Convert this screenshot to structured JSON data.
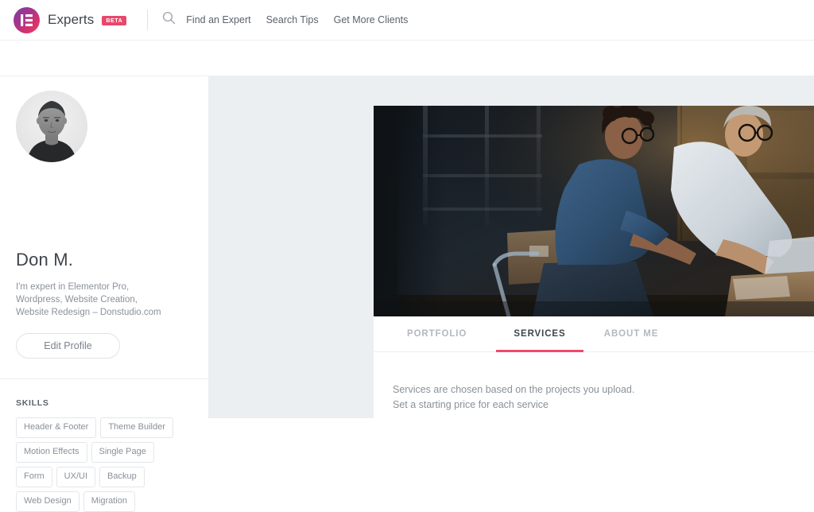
{
  "topbar": {
    "brand_name": "Experts",
    "beta_label": "BETA",
    "logo_icon": "elementor-logo-icon",
    "search_icon": "search-icon",
    "links": [
      {
        "label": "Find an Expert"
      },
      {
        "label": "Search Tips"
      },
      {
        "label": "Get More Clients"
      }
    ],
    "accent_color": "#e8486b",
    "logo_gradient_from": "#7a3f9d",
    "logo_gradient_to": "#e8476b"
  },
  "sidebar": {
    "avatar_alt": "user-avatar",
    "name": "Don M.",
    "bio": "I'm expert in Elementor Pro, Wordpress, Website Creation, Website Redesign – Donstudio.com",
    "edit_profile_label": "Edit Profile",
    "skills_title": "SKILLS",
    "skills": [
      {
        "label": "Header & Footer"
      },
      {
        "label": "Theme Builder"
      },
      {
        "label": "Motion Effects"
      },
      {
        "label": "Single Page"
      },
      {
        "label": "Form"
      },
      {
        "label": "UX/UI"
      },
      {
        "label": "Backup"
      },
      {
        "label": "Web Design"
      },
      {
        "label": "Migration"
      }
    ]
  },
  "content": {
    "cover_alt": "cover-photo-two-people-packing-boxes",
    "tabs": [
      {
        "label": "PORTFOLIO",
        "active": false
      },
      {
        "label": "SERVICES",
        "active": true
      },
      {
        "label": "ABOUT ME",
        "active": false
      }
    ],
    "active_tab_underline_color": "#f0496b",
    "services_line_1": "Services are chosen based on the projects you upload.",
    "services_line_2": "Set a starting price for each service"
  }
}
